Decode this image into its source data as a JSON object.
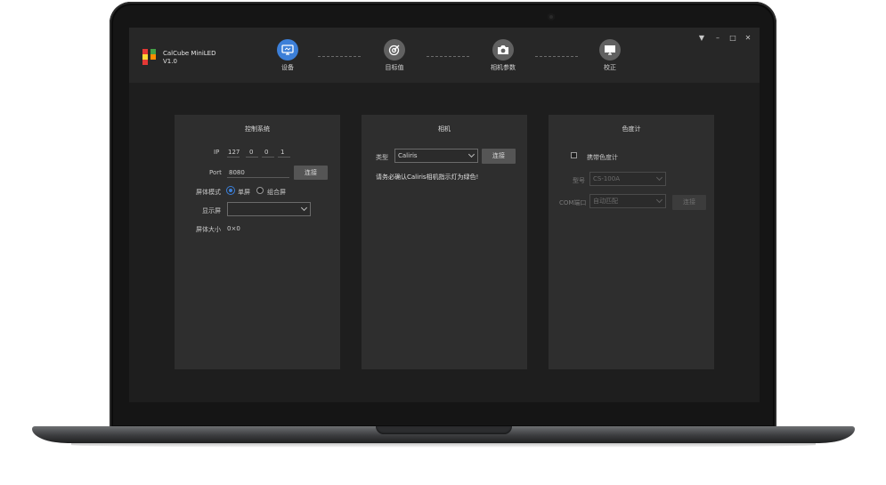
{
  "app": {
    "name": "CalCube MiniLED",
    "version": "V1.0",
    "logo_colors": [
      "#e53935",
      "#43a047",
      "#fdd835",
      "#fb8c00",
      "#e53935"
    ],
    "accent": "#3c7fd8"
  },
  "steps": [
    {
      "label": "设备",
      "icon": "monitor-icon",
      "active": true
    },
    {
      "label": "目标值",
      "icon": "target-icon",
      "active": false
    },
    {
      "label": "相机参数",
      "icon": "camera-icon",
      "active": false
    },
    {
      "label": "校正",
      "icon": "display-icon",
      "active": false
    }
  ],
  "window_controls": {
    "menu": "▼",
    "minimize": "–",
    "maximize": "□",
    "close": "✕"
  },
  "control_panel": {
    "title": "控制系统",
    "ip_label": "IP",
    "ip": [
      "127",
      "0",
      "0",
      "1"
    ],
    "port_label": "Port",
    "port": "8080",
    "connect_label": "连接",
    "mode_label": "屏体模式",
    "mode_options": [
      "单屏",
      "组合屏"
    ],
    "mode_selected": "单屏",
    "display_label": "显示屏",
    "display_value": "",
    "size_label": "屏体大小",
    "size_value": "0×0"
  },
  "camera_panel": {
    "title": "相机",
    "type_label": "类型",
    "type_value": "Caliris",
    "connect_label": "连接",
    "notice": "请务必确认Caliris相机指示灯为绿色!"
  },
  "colorimeter_panel": {
    "title": "色度计",
    "carry_label": "携带色度计",
    "carry_checked": false,
    "model_label": "型号",
    "model_value": "CS-100A",
    "port_label": "COM端口",
    "port_value": "自动匹配",
    "connect_label": "连接"
  }
}
